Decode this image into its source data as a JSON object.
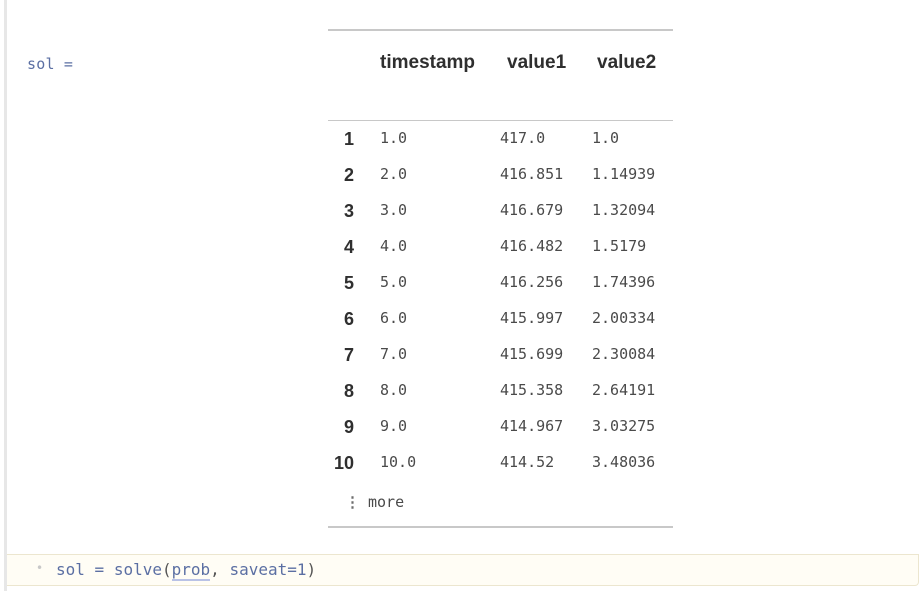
{
  "cell": {
    "var_label": "sol ="
  },
  "table": {
    "columns": [
      "timestamp",
      "value1",
      "value2"
    ],
    "rows": [
      {
        "n": "1",
        "timestamp": "1.0",
        "value1": "417.0",
        "value2": "1.0"
      },
      {
        "n": "2",
        "timestamp": "2.0",
        "value1": "416.851",
        "value2": "1.14939"
      },
      {
        "n": "3",
        "timestamp": "3.0",
        "value1": "416.679",
        "value2": "1.32094"
      },
      {
        "n": "4",
        "timestamp": "4.0",
        "value1": "416.482",
        "value2": "1.5179"
      },
      {
        "n": "5",
        "timestamp": "5.0",
        "value1": "416.256",
        "value2": "1.74396"
      },
      {
        "n": "6",
        "timestamp": "6.0",
        "value1": "415.997",
        "value2": "2.00334"
      },
      {
        "n": "7",
        "timestamp": "7.0",
        "value1": "415.699",
        "value2": "2.30084"
      },
      {
        "n": "8",
        "timestamp": "8.0",
        "value1": "415.358",
        "value2": "2.64191"
      },
      {
        "n": "9",
        "timestamp": "9.0",
        "value1": "414.967",
        "value2": "3.03275"
      },
      {
        "n": "10",
        "timestamp": "10.0",
        "value1": "414.52",
        "value2": "3.48036"
      }
    ],
    "more_label": "more",
    "more_icon": "vertical-ellipsis-icon"
  },
  "code": {
    "bullet": "•",
    "var": "sol",
    "eq": "=",
    "fn": "solve",
    "open": "(",
    "arg1": "prob",
    "comma": ",",
    "kw": "saveat",
    "kw_eq": "=",
    "val": "1",
    "close": ")"
  },
  "colors": {
    "accent": "#5b6fa3",
    "code_bg": "#fffdf5",
    "rule": "#c8c8c8"
  }
}
